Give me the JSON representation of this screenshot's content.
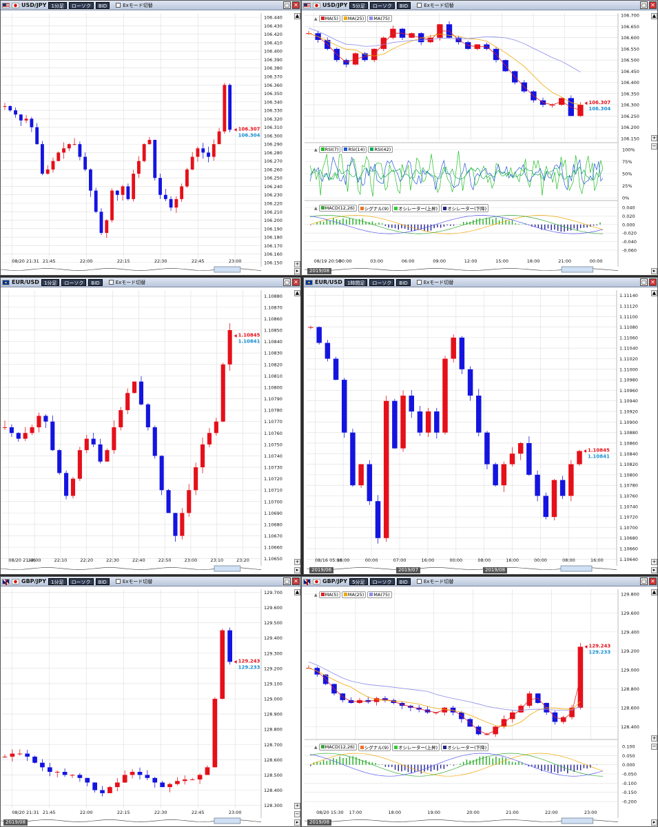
{
  "windows": [
    {
      "id": "w1",
      "symbol": "USD/JPY",
      "flags": [
        "f-us",
        "f-jp"
      ],
      "period": "1分足",
      "style": "ローソク",
      "side": "BID",
      "exmode": "Exモード切替",
      "bid_label": "106.307",
      "ask_label": "106.304",
      "x_ticks": [
        "08/20 21:31",
        "21:45",
        "22:00",
        "22:15",
        "22:30",
        "22:45",
        "23:00"
      ],
      "year_labels": [],
      "show_minmax": false
    },
    {
      "id": "w2",
      "symbol": "USD/JPY",
      "flags": [
        "f-us",
        "f-jp"
      ],
      "period": "5分足",
      "style": "ローソク",
      "side": "BID",
      "exmode": "Exモード切替",
      "bid_label": "106.307",
      "ask_label": "106.304",
      "ma_legend": [
        "MA(5)",
        "MA(25)",
        "MA(75)"
      ],
      "rsi_legend": [
        "RSI(7)",
        "RSI(14)",
        "RSI(42)"
      ],
      "macd_legend": [
        "MACD(12,26)",
        "シグナル(9)",
        "オシレーター(上昇)",
        "オシレーター(下降)"
      ],
      "x_ticks": [
        "08/19 20:50",
        "00:00",
        "03:00",
        "06:00",
        "09:00",
        "12:00",
        "15:00",
        "18:00",
        "21:00",
        "00:00"
      ],
      "year_labels": [
        "2019/08"
      ],
      "rsi_y_labels": [
        "100%",
        "75%",
        "50%",
        "25%",
        "0%"
      ],
      "macd_y_labels": [
        "0.040",
        "0.020",
        "0.000",
        "-0.020",
        "-0.040",
        "-0.060"
      ]
    },
    {
      "id": "w3",
      "symbol": "EUR/USD",
      "flags": [
        "f-eu"
      ],
      "period": "1分足",
      "style": "ローソク",
      "side": "BID",
      "exmode": "Exモード切替",
      "bid_label": "1.10845",
      "ask_label": "1.10841",
      "x_ticks": [
        "08/20 21:46",
        "22:00",
        "22:10",
        "22:20",
        "22:30",
        "22:40",
        "22:50",
        "23:00",
        "23:10",
        "23:20"
      ],
      "year_labels": []
    },
    {
      "id": "w4",
      "symbol": "EUR/USD",
      "flags": [
        "f-eu"
      ],
      "period": "1時間足",
      "style": "ローソク",
      "side": "BID",
      "exmode": "Exモード切替",
      "bid_label": "1.10845",
      "ask_label": "1.10841",
      "x_ticks": [
        "08/16 05:00",
        "16:00",
        "00:00",
        "07:00",
        "16:00",
        "00:00",
        "08:00",
        "16:00",
        "00:00",
        "08:00",
        "16:00"
      ],
      "year_labels": [
        "2019/06",
        "2019/07",
        "2019/08"
      ]
    },
    {
      "id": "w5",
      "symbol": "GBP/JPY",
      "flags": [
        "f-gb",
        "f-jp"
      ],
      "period": "1分足",
      "style": "ローソク",
      "side": "BID",
      "exmode": "Exモード切替",
      "bid_label": "129.243",
      "ask_label": "129.233",
      "x_ticks": [
        "08/20 21:31",
        "21:45",
        "22:00",
        "22:15",
        "22:30",
        "22:45",
        "23:00"
      ],
      "year_labels": [
        "2019/08"
      ]
    },
    {
      "id": "w6",
      "symbol": "GBP/JPY",
      "flags": [
        "f-gb",
        "f-jp"
      ],
      "period": "5分足",
      "style": "ローソク",
      "side": "BID",
      "exmode": "Exモード切替",
      "bid_label": "129.243",
      "ask_label": "129.233",
      "ma_legend": [
        "MA(5)",
        "MA(25)",
        "MA(75)"
      ],
      "macd_legend": [
        "MACD(12,26)",
        "シグナル(9)",
        "オシレーター(上昇)",
        "オシレーター(下降)"
      ],
      "x_ticks": [
        "08/20 15:30",
        "17:00",
        "18:00",
        "19:00",
        "20:00",
        "21:00",
        "22:00",
        "23:00"
      ],
      "year_labels": [
        "2019/08"
      ],
      "macd_y_labels": [
        "0.100",
        "0.050",
        "0.000",
        "-0.050",
        "-0.100",
        "-0.150",
        "-0.200"
      ]
    }
  ],
  "colors": {
    "up": "#e5101a",
    "down": "#1414e0",
    "bid": "#e5101a",
    "ask": "#1a8fd0",
    "ma5": "#e02020",
    "ma25": "#f0a800",
    "ma75": "#8a8ae8",
    "grid": "#dedede"
  },
  "chart_data": [
    {
      "type": "candlestick",
      "title": "USD/JPY 1分足",
      "ylim": [
        106.145,
        106.445
      ],
      "y_ticks": [
        106.44,
        106.43,
        106.42,
        106.41,
        106.4,
        106.39,
        106.38,
        106.37,
        106.36,
        106.35,
        106.34,
        106.33,
        106.32,
        106.31,
        106.3,
        106.29,
        106.28,
        106.27,
        106.26,
        106.25,
        106.24,
        106.23,
        106.22,
        106.21,
        106.2,
        106.19,
        106.18,
        106.17,
        106.16,
        106.15
      ],
      "last_bid": 106.307,
      "last_ask": 106.304,
      "close_path": [
        106.335,
        106.33,
        106.325,
        106.318,
        106.32,
        106.31,
        106.29,
        106.255,
        106.26,
        106.27,
        106.28,
        106.285,
        106.29,
        106.29,
        106.275,
        106.26,
        106.235,
        106.21,
        106.185,
        106.2,
        106.235,
        106.23,
        106.24,
        106.225,
        106.255,
        106.27,
        106.29,
        106.295,
        106.25,
        106.23,
        106.225,
        106.215,
        106.225,
        106.24,
        106.26,
        106.275,
        106.285,
        106.28,
        106.275,
        106.29,
        106.305,
        106.36,
        106.307
      ]
    },
    {
      "type": "candlestick",
      "title": "USD/JPY 5分足",
      "ylim": [
        106.14,
        106.71
      ],
      "y_ticks": [
        106.7,
        106.65,
        106.6,
        106.55,
        106.5,
        106.45,
        106.4,
        106.35,
        106.3,
        106.25,
        106.2,
        106.15
      ],
      "last_bid": 106.307,
      "last_ask": 106.304,
      "close_path": [
        106.62,
        106.59,
        106.55,
        106.5,
        106.48,
        106.53,
        106.5,
        106.55,
        106.6,
        106.64,
        106.6,
        106.62,
        106.58,
        106.6,
        106.66,
        106.6,
        106.58,
        106.55,
        106.57,
        106.55,
        106.5,
        106.45,
        106.4,
        106.36,
        106.32,
        106.3,
        106.3,
        106.33,
        106.25,
        106.3
      ],
      "indicators": [
        "MA(5)",
        "MA(25)",
        "MA(75)",
        "RSI(7)",
        "RSI(14)",
        "RSI(42)",
        "MACD(12,26)",
        "シグナル(9)"
      ]
    },
    {
      "type": "candlestick",
      "title": "EUR/USD 1分足",
      "ylim": [
        1.10645,
        1.10885
      ],
      "y_ticks": [
        1.1088,
        1.1087,
        1.1086,
        1.1085,
        1.1084,
        1.1083,
        1.1082,
        1.1081,
        1.108,
        1.1079,
        1.1078,
        1.1077,
        1.1076,
        1.1075,
        1.1074,
        1.1073,
        1.1072,
        1.1071,
        1.107,
        1.1069,
        1.1068,
        1.1067,
        1.1066,
        1.1065
      ],
      "last_bid": 1.10845,
      "last_ask": 1.10841,
      "close_path": [
        1.10765,
        1.1076,
        1.10755,
        1.1076,
        1.10765,
        1.10775,
        1.1077,
        1.10745,
        1.10725,
        1.10705,
        1.1072,
        1.10745,
        1.10755,
        1.1075,
        1.10735,
        1.10745,
        1.10765,
        1.1078,
        1.10795,
        1.10805,
        1.10785,
        1.10765,
        1.1074,
        1.1071,
        1.1069,
        1.1067,
        1.1069,
        1.1071,
        1.1073,
        1.1075,
        1.1076,
        1.1077,
        1.1082,
        1.1085
      ]
    },
    {
      "type": "candlestick",
      "title": "EUR/USD 1時間足",
      "ylim": [
        1.1063,
        1.1115
      ],
      "y_ticks": [
        1.1114,
        1.1112,
        1.111,
        1.1108,
        1.1106,
        1.1104,
        1.1102,
        1.11,
        1.1098,
        1.1096,
        1.1094,
        1.1092,
        1.109,
        1.1088,
        1.1086,
        1.1084,
        1.1082,
        1.108,
        1.1078,
        1.1076,
        1.1074,
        1.1072,
        1.107,
        1.1068,
        1.1066,
        1.1064
      ],
      "last_bid": 1.10845,
      "last_ask": 1.10841,
      "close_path": [
        1.1108,
        1.1105,
        1.1102,
        1.1098,
        1.1088,
        1.1078,
        1.1082,
        1.1075,
        1.1068,
        1.1094,
        1.1085,
        1.1095,
        1.1092,
        1.1088,
        1.1092,
        1.1088,
        1.1102,
        1.1106,
        1.11,
        1.1095,
        1.1088,
        1.1082,
        1.1078,
        1.1082,
        1.1084,
        1.1086,
        1.108,
        1.1076,
        1.1072,
        1.1079,
        1.1076,
        1.1082,
        1.10845
      ]
    },
    {
      "type": "candlestick",
      "title": "GBP/JPY 1分足",
      "ylim": [
        128.28,
        129.72
      ],
      "y_ticks": [
        129.7,
        129.6,
        129.5,
        129.4,
        129.3,
        129.2,
        129.1,
        129.0,
        128.9,
        128.8,
        128.7,
        128.6,
        128.5,
        128.4,
        128.3
      ],
      "last_bid": 129.243,
      "last_ask": 129.233,
      "close_path": [
        128.62,
        128.64,
        128.64,
        128.62,
        128.58,
        128.55,
        128.52,
        128.52,
        128.5,
        128.5,
        128.48,
        128.45,
        128.4,
        128.38,
        128.42,
        128.45,
        128.5,
        128.52,
        128.5,
        128.48,
        128.45,
        128.42,
        128.44,
        128.46,
        128.47,
        128.47,
        128.5,
        128.55,
        129.0,
        129.45,
        129.243
      ]
    },
    {
      "type": "candlestick",
      "title": "GBP/JPY 5分足",
      "ylim": [
        128.25,
        129.85
      ],
      "y_ticks": [
        129.8,
        129.6,
        129.4,
        129.2,
        129.0,
        128.8,
        128.6,
        128.4
      ],
      "last_bid": 129.243,
      "last_ask": 129.233,
      "close_path": [
        129.02,
        128.95,
        128.85,
        128.75,
        128.68,
        128.65,
        128.68,
        128.66,
        128.7,
        128.68,
        128.65,
        128.62,
        128.6,
        128.58,
        128.55,
        128.55,
        128.6,
        128.55,
        128.48,
        128.4,
        128.32,
        128.32,
        128.4,
        128.48,
        128.55,
        128.62,
        128.75,
        128.65,
        128.55,
        128.45,
        128.5,
        128.6,
        129.243
      ],
      "indicators": [
        "MA(5)",
        "MA(25)",
        "MA(75)",
        "MACD(12,26)",
        "シグナル(9)"
      ]
    }
  ]
}
